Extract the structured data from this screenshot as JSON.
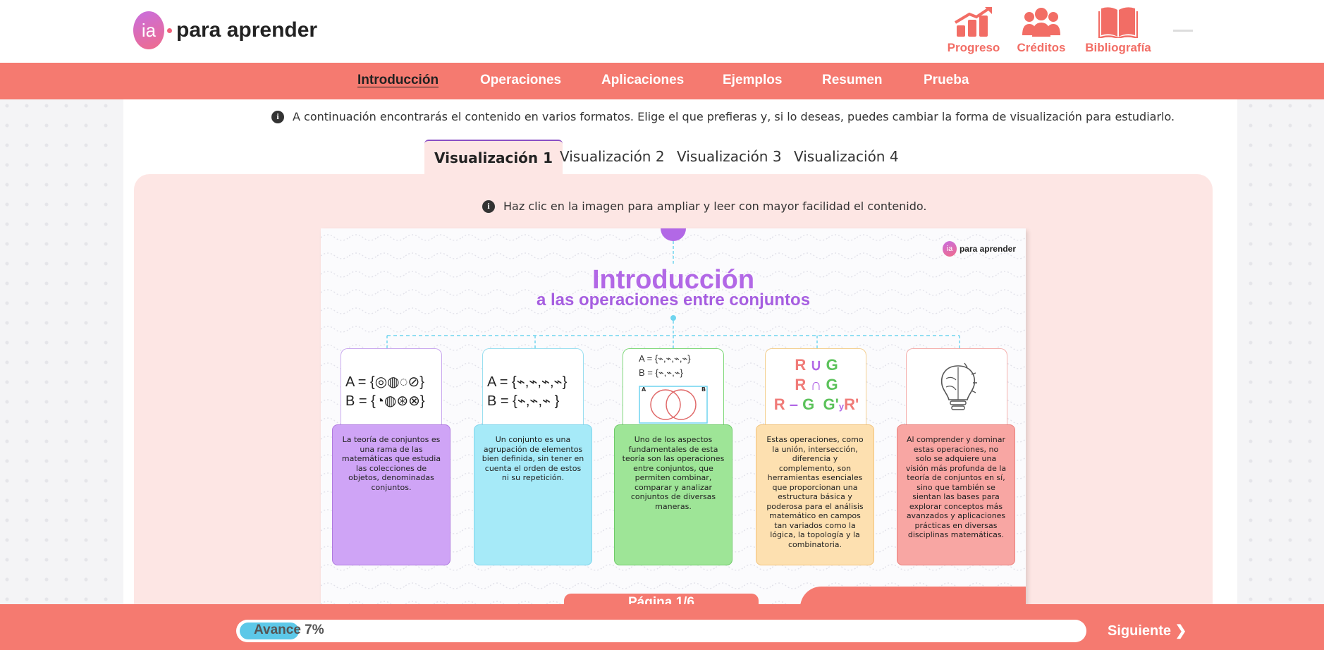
{
  "brand": {
    "logo_mark": "ia",
    "logo_text": "para aprender"
  },
  "header_actions": [
    {
      "label": "Progreso",
      "icon": "chart-up-icon"
    },
    {
      "label": "Créditos",
      "icon": "users-icon"
    },
    {
      "label": "Bibliografía",
      "icon": "book-icon"
    }
  ],
  "nav": {
    "items": [
      "Introducción",
      "Operaciones",
      "Aplicaciones",
      "Ejemplos",
      "Resumen",
      "Prueba"
    ],
    "active": "Introducción"
  },
  "info_text": "A continuación encontrarás el contenido en varios formatos. Elige el que prefieras y, si lo deseas, puedes cambiar la forma de visualización para estudiarlo.",
  "tabs": [
    "Visualización 1",
    "Visualización 2",
    "Visualización 3",
    "Visualización 4"
  ],
  "active_tab": "Visualización 1",
  "panel_info": "Haz clic en la imagen para ampliar y leer con mayor facilidad el contenido.",
  "slide": {
    "logo_mark": "ia",
    "logo_text": "para aprender",
    "title": "Introducción",
    "subtitle": "a las operaciones entre conjuntos",
    "card1": {
      "line_a": "A = {",
      "line_b": "B = {",
      "close": "}",
      "text": "La teoría de conjuntos es una rama de las matemáticas que estudia las colecciones de objetos, denominadas conjuntos."
    },
    "card2": {
      "line_a": "A = {",
      "line_b": "B = {",
      "close": "}",
      "text": "Un conjunto es una agrupación de elementos bien definida, sin tener en cuenta el orden de estos ni su repetición."
    },
    "card3": {
      "line_a": "A = {",
      "line_b": "B = {",
      "close": "}",
      "venn_a": "A",
      "venn_b": "B",
      "text": "Uno de los aspectos fundamentales de esta teoría son las operaciones entre conjuntos, que permiten combinar, comparar y analizar conjuntos de diversas maneras."
    },
    "card4": {
      "op1_a": "R",
      "op1_sym": "∪",
      "op1_b": "G",
      "op2_a": "R",
      "op2_sym": "∩",
      "op2_b": "G",
      "op3_a": "R",
      "op3_sym": "–",
      "op3_b": "G",
      "op4_a": "G'",
      "op4_y": "y",
      "op4_b": "R'",
      "text": "Estas operaciones, como la unión, intersección, diferencia y complemento, son herramientas esenciales que proporcionan una estructura básica y poderosa para el análisis matemático en campos tan variados como la lógica, la topología y la combinatoria."
    },
    "card5": {
      "text": "Al comprender y dominar estas operaciones, no solo se adquiere una visión más profunda de la teoría de conjuntos en sí, sino que también se sientan las bases para explorar conceptos más avanzados y aplicaciones prácticas en diversas disciplinas matemáticas."
    },
    "page_label": "Página 1/6",
    "colors": {
      "purple": "#cfa4f6",
      "cyan": "#a6eaf8",
      "green": "#9ee597",
      "orange": "#fde0b0",
      "red": "#f8a6a3"
    }
  },
  "progress": {
    "label": "Avance 7%",
    "value": 0.07
  },
  "next_label": "Siguiente ❯"
}
